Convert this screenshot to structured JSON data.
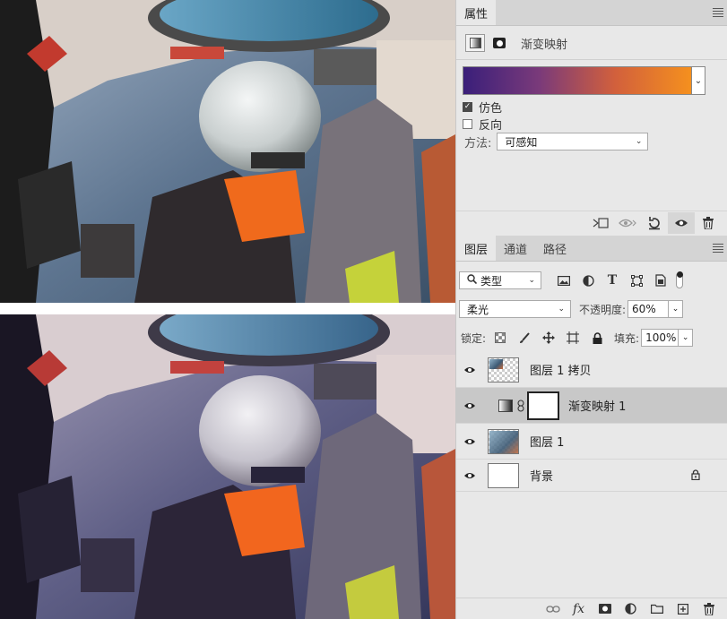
{
  "properties_panel": {
    "tab_label": "属性",
    "title": "渐变映射",
    "gradient": {
      "colors": [
        "#3a1f7a",
        "#7a3a7a",
        "#d2603c",
        "#f5901e"
      ]
    },
    "dither_label": "仿色",
    "dither_checked": true,
    "reverse_label": "反向",
    "reverse_checked": false,
    "method_label": "方法:",
    "method_value": "可感知",
    "footer_icons": [
      "clip-to-layer-icon",
      "view-previous-state-icon",
      "reset-icon",
      "visibility-icon",
      "trash-icon"
    ]
  },
  "layers_panel": {
    "tabs": [
      {
        "label": "图层",
        "active": true
      },
      {
        "label": "通道",
        "active": false
      },
      {
        "label": "路径",
        "active": false
      }
    ],
    "filter_kind": "类型",
    "filter_icons": [
      "image-filter-icon",
      "adjustment-filter-icon",
      "type-filter-icon",
      "shape-filter-icon",
      "smart-object-filter-icon"
    ],
    "blend_mode": "柔光",
    "opacity_label": "不透明度:",
    "opacity_value": "60%",
    "lock_label": "锁定:",
    "fill_label": "填充:",
    "fill_value": "100%",
    "layers": [
      {
        "name": "图层 1 拷贝",
        "thumb": "photo",
        "selected": false,
        "locked": false
      },
      {
        "name": "渐变映射 1",
        "thumb": "adjustment",
        "selected": true,
        "locked": false
      },
      {
        "name": "图层 1",
        "thumb": "photo",
        "selected": false,
        "locked": false
      },
      {
        "name": "背景",
        "thumb": "white",
        "selected": false,
        "locked": true
      }
    ],
    "bottom_icons": [
      "link-layers-icon",
      "fx-icon",
      "add-mask-icon",
      "new-adjustment-icon",
      "new-group-icon",
      "new-layer-icon",
      "delete-layer-icon"
    ],
    "fx_label": "fx"
  }
}
